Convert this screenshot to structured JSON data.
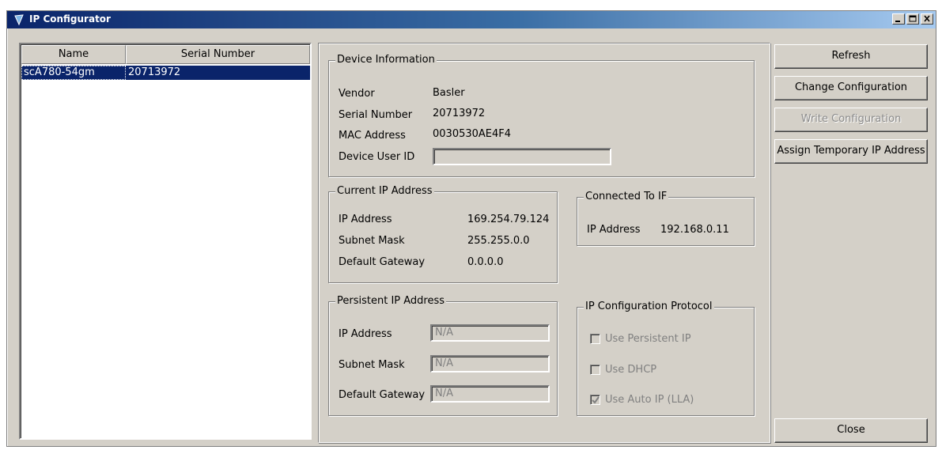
{
  "window": {
    "title": "IP Configurator",
    "controls": [
      "minimize-icon",
      "maximize-icon",
      "close-icon"
    ]
  },
  "device_list": {
    "columns": [
      "Name",
      "Serial Number"
    ],
    "rows": [
      {
        "name": "scA780-54gm",
        "serial": "20713972",
        "selected": true
      }
    ]
  },
  "device_info": {
    "legend": "Device Information",
    "vendor_label": "Vendor",
    "vendor_value": "Basler",
    "serial_label": "Serial Number",
    "serial_value": "20713972",
    "mac_label": "MAC Address",
    "mac_value": "0030530AE4F4",
    "user_id_label": "Device User ID",
    "user_id_value": ""
  },
  "current_ip": {
    "legend": "Current IP Address",
    "ip_label": "IP Address",
    "ip_value": "169.254.79.124",
    "mask_label": "Subnet Mask",
    "mask_value": "255.255.0.0",
    "gateway_label": "Default Gateway",
    "gateway_value": "0.0.0.0"
  },
  "connected_to": {
    "legend": "Connected To IF",
    "ip_label": "IP Address",
    "ip_value": "192.168.0.11"
  },
  "persistent_ip": {
    "legend": "Persistent IP Address",
    "ip_label": "IP Address",
    "ip_value": "N/A",
    "mask_label": "Subnet Mask",
    "mask_value": "N/A",
    "gateway_label": "Default Gateway",
    "gateway_value": "N/A"
  },
  "protocol": {
    "legend": "IP Configuration Protocol",
    "persistent_label": "Use Persistent IP",
    "persistent_checked": false,
    "dhcp_label": "Use DHCP",
    "dhcp_checked": false,
    "auto_label": "Use Auto IP (LLA)",
    "auto_checked": true
  },
  "buttons": {
    "refresh": "Refresh",
    "change_config": "Change Configuration",
    "write_config": "Write Configuration",
    "assign_temp_ip": "Assign Temporary IP Address",
    "close": "Close"
  }
}
